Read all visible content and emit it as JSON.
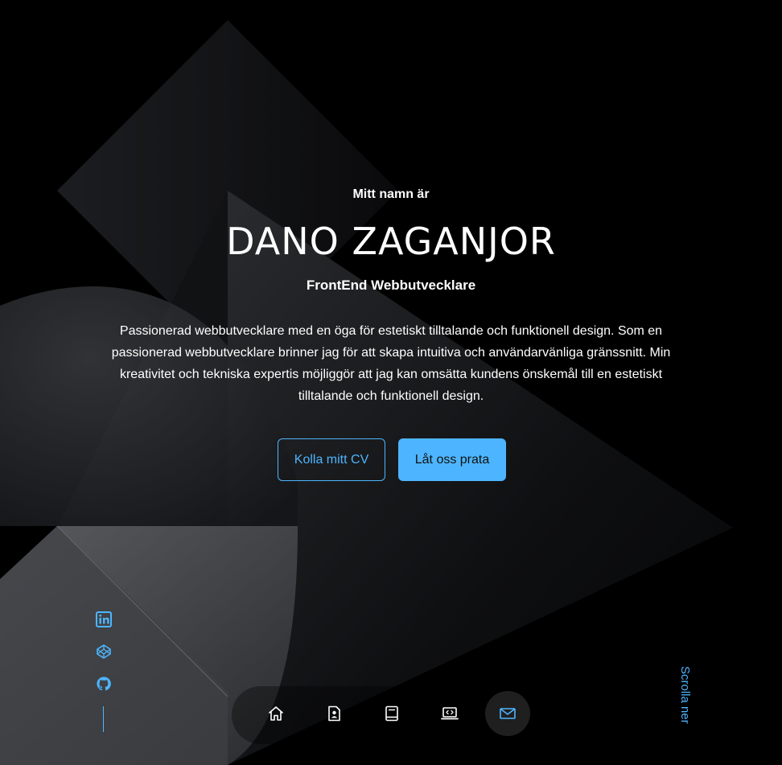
{
  "hero": {
    "intro": "Mitt namn är",
    "name": "DANO ZAGANJOR",
    "role": "FrontEnd Webbutvecklare",
    "description": "Passionerad webbutvecklare med en öga för estetiskt tilltalande och funktionell design. Som en passionerad webbutvecklare brinner jag för att skapa intuitiva och användarvänliga gränssnitt. Min kreativitet och tekniska expertis möjliggör att jag kan omsätta kundens önskemål till en estetiskt tilltalande och funktionell design.",
    "cv_button": "Kolla mitt CV",
    "talk_button": "Låt oss prata"
  },
  "socials": [
    {
      "icon": "linkedin-icon"
    },
    {
      "icon": "codepen-icon"
    },
    {
      "icon": "github-icon"
    }
  ],
  "scroll_label": "Scrolla ner",
  "nav": {
    "items": [
      {
        "icon": "home-icon"
      },
      {
        "icon": "profile-icon"
      },
      {
        "icon": "book-icon"
      },
      {
        "icon": "laptop-code-icon"
      },
      {
        "icon": "mail-icon",
        "active": true
      }
    ]
  },
  "colors": {
    "accent": "#4db5ff",
    "background": "#000000",
    "text": "#ffffff"
  }
}
